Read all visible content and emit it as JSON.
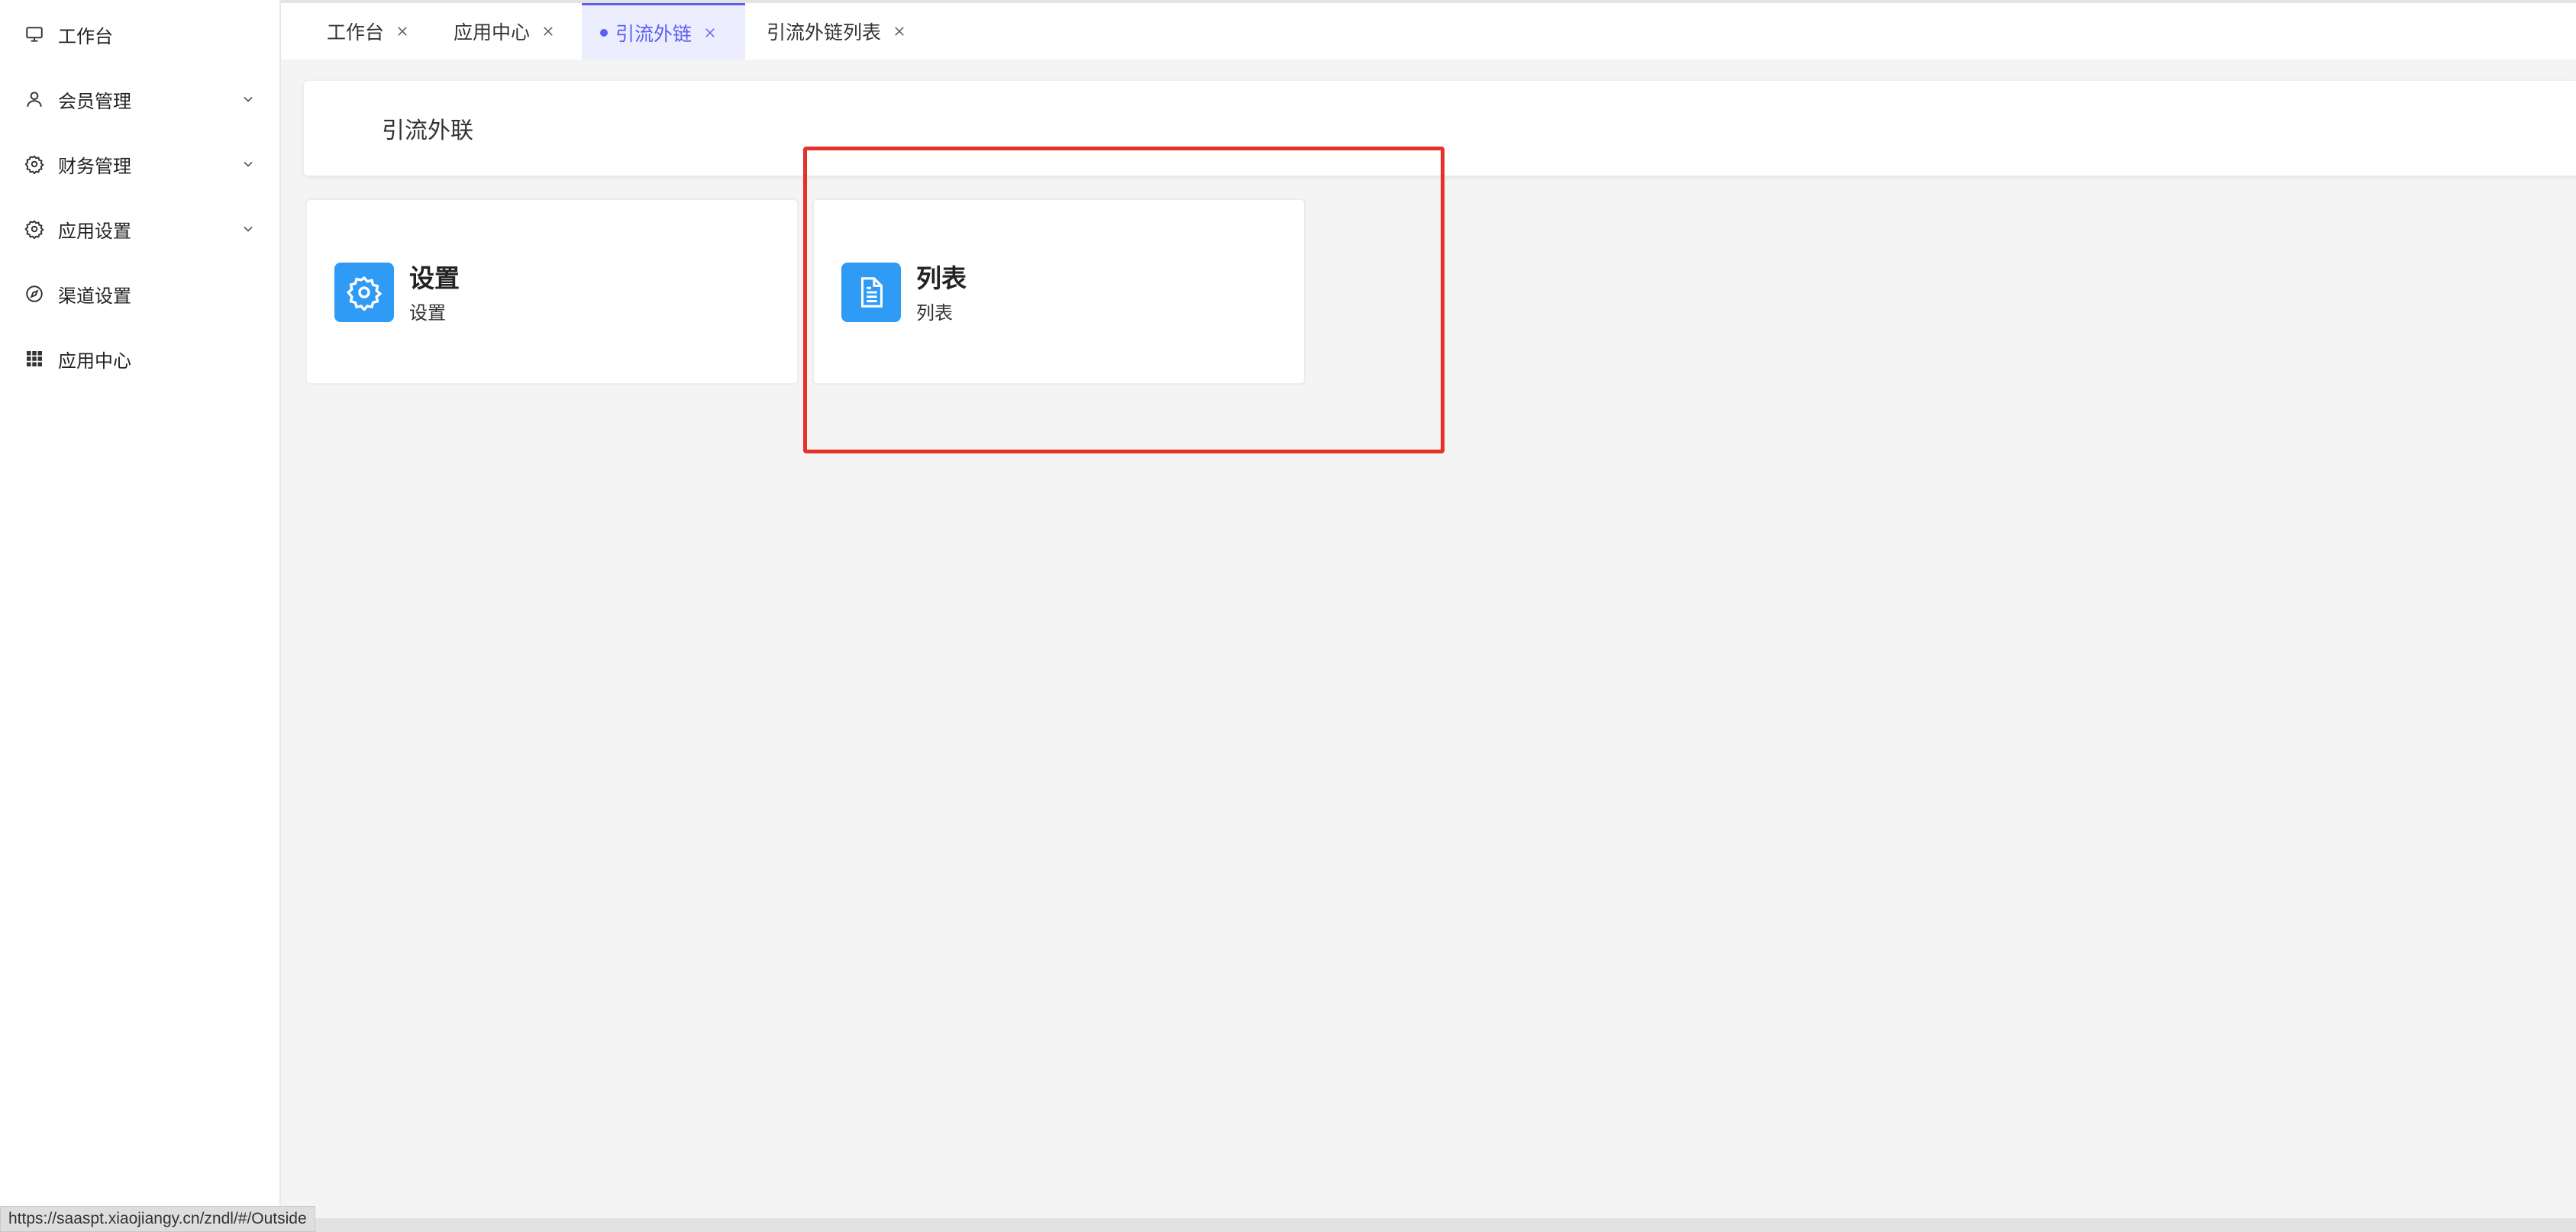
{
  "sidebar": {
    "items": [
      {
        "label": "工作台",
        "icon": "monitor-icon",
        "has_arrow": false
      },
      {
        "label": "会员管理",
        "icon": "user-icon",
        "has_arrow": true
      },
      {
        "label": "财务管理",
        "icon": "gear-icon",
        "has_arrow": true
      },
      {
        "label": "应用设置",
        "icon": "gear-icon",
        "has_arrow": true
      },
      {
        "label": "渠道设置",
        "icon": "compass-icon",
        "has_arrow": false
      },
      {
        "label": "应用中心",
        "icon": "grid-icon",
        "has_arrow": false
      }
    ]
  },
  "tabs": [
    {
      "label": "工作台",
      "active": false
    },
    {
      "label": "应用中心",
      "active": false
    },
    {
      "label": "引流外链",
      "active": true
    },
    {
      "label": "引流外链列表",
      "active": false
    }
  ],
  "header": {
    "title": "引流外联"
  },
  "cards": [
    {
      "title": "设置",
      "subtitle": "设置",
      "icon": "gear-icon"
    },
    {
      "title": "列表",
      "subtitle": "列表",
      "icon": "document-icon"
    }
  ],
  "status_bar": {
    "url": "https://saaspt.xiaojiangy.cn/zndl/#/Outside"
  },
  "colors": {
    "accent": "#5b5ff0",
    "card_icon_bg": "#2f9bf5",
    "highlight": "#e8302a"
  }
}
